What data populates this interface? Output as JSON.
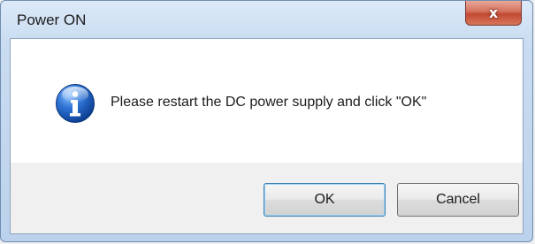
{
  "window": {
    "title": "Power ON",
    "close_label": "x"
  },
  "dialog": {
    "icon": "info-icon",
    "message": "Please restart the DC power supply and click \"OK\""
  },
  "buttons": {
    "ok_label": "OK",
    "cancel_label": "Cancel"
  },
  "colors": {
    "title_bar": "#c9dcf1",
    "close_button": "#c14a33",
    "info_icon": "#1f5fb8",
    "default_button_border": "#3c7fb1"
  }
}
